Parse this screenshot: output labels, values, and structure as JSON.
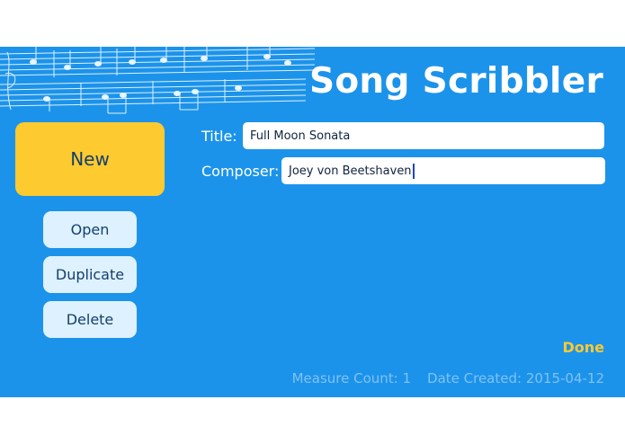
{
  "header": {
    "app_title": "Song Scribbler"
  },
  "sidebar": {
    "new_label": "New",
    "open_label": "Open",
    "duplicate_label": "Duplicate",
    "delete_label": "Delete"
  },
  "form": {
    "title_label": "Title:",
    "title_value": "Full Moon Sonata",
    "composer_label": "Composer:",
    "composer_value": "Joey von Beetshaven"
  },
  "actions": {
    "done_label": "Done"
  },
  "footer": {
    "measure_count": "Measure Count: 1",
    "date_created": "Date Created: 2015-04-12"
  },
  "colors": {
    "background": "#1c93ea",
    "accent": "#fdca2f",
    "button": "#def1fe",
    "footer_text": "#7fc2f3"
  },
  "icons": {
    "decoration": "sheet-music-decoration"
  }
}
